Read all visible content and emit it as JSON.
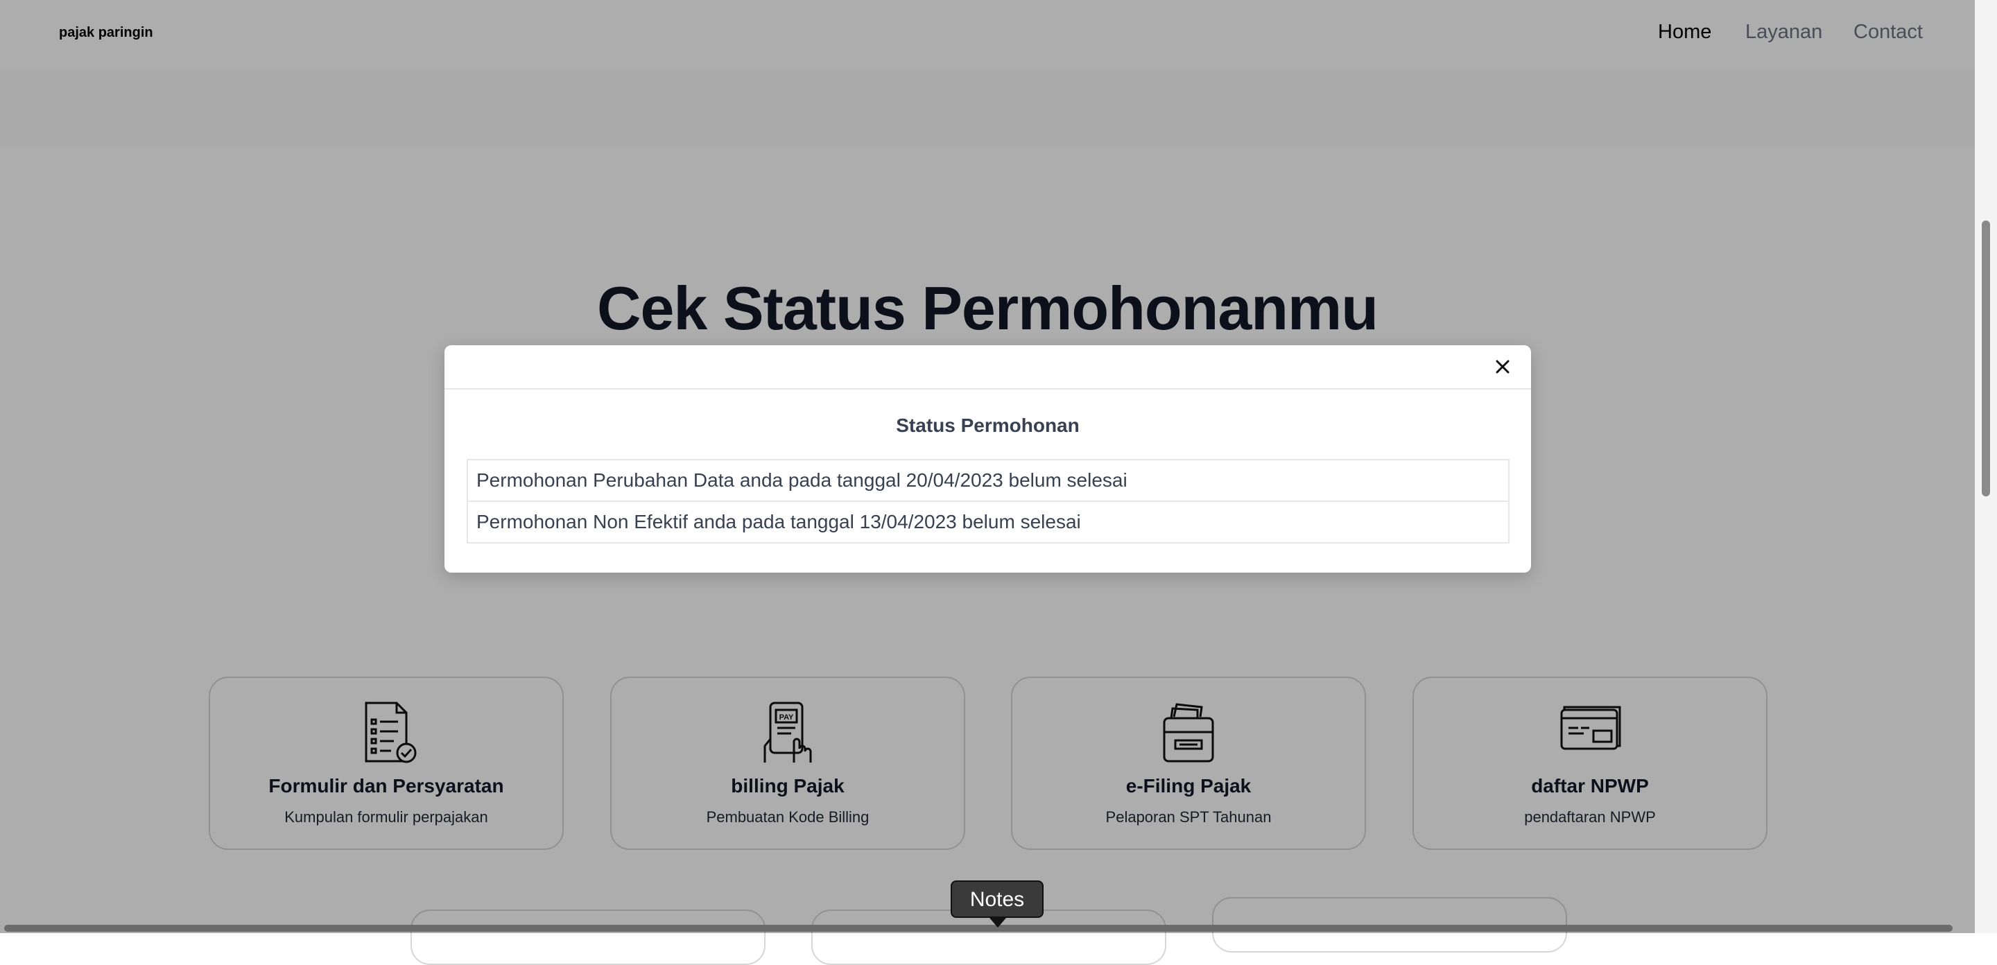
{
  "navbar": {
    "brand": "pajak paringin",
    "links": [
      {
        "label": "Home",
        "active": true
      },
      {
        "label": "Layanan",
        "active": false
      },
      {
        "label": "Contact",
        "active": false
      }
    ]
  },
  "hero": {
    "title": "Cek Status Permohonanmu"
  },
  "cards": [
    {
      "title": "Formulir dan Persyaratan",
      "description": "Kumpulan formulir perpajakan",
      "icon": "checklist-document-icon"
    },
    {
      "title": "billing Pajak",
      "description": "Pembuatan Kode Billing",
      "icon": "mobile-pay-icon"
    },
    {
      "title": "e-Filing Pajak",
      "description": "Pelaporan SPT Tahunan",
      "icon": "file-cabinet-icon"
    },
    {
      "title": "daftar NPWP",
      "description": "pendaftaran NPWP",
      "icon": "id-card-icon"
    }
  ],
  "modal": {
    "title": "Status Permohonan",
    "close_icon": "close-icon",
    "items": [
      "Permohonan Perubahan Data anda pada tanggal 20/04/2023 belum selesai",
      "Permohonan Non Efektif anda pada tanggal 13/04/2023 belum selesai"
    ]
  },
  "notes": {
    "label": "Notes"
  },
  "colors": {
    "overlay": "rgba(0,0,0,0.32)",
    "text_dark": "#111827",
    "card_border": "#d6d6d6"
  }
}
